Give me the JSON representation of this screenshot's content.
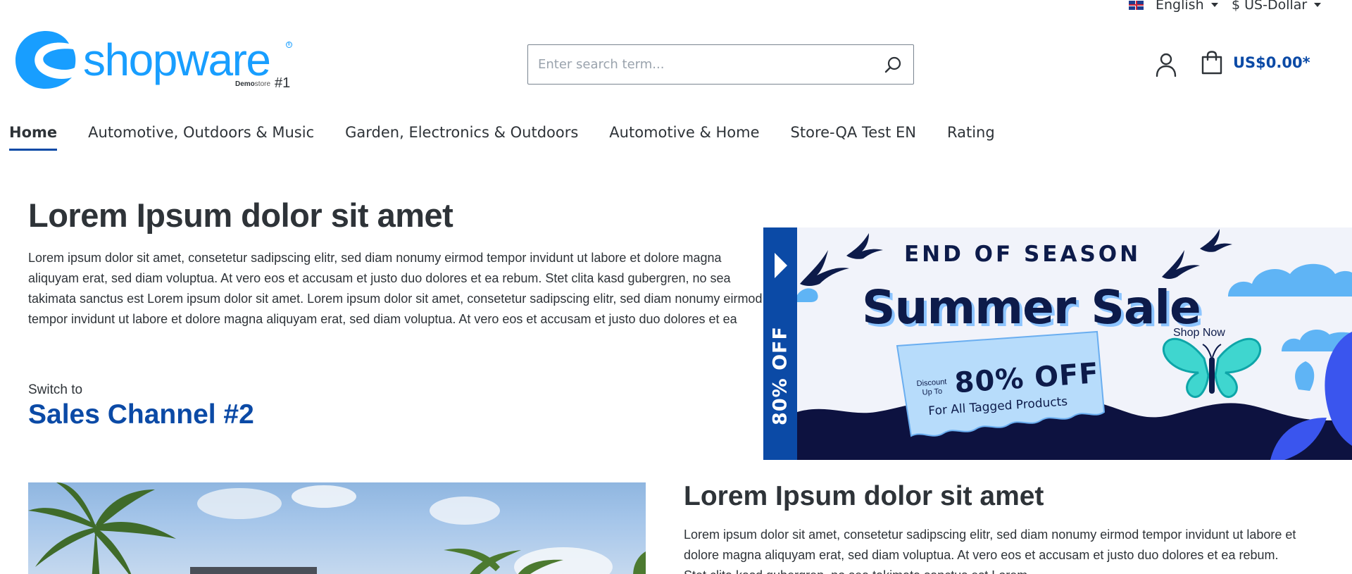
{
  "topbar": {
    "language": "English",
    "currency": "$ US-Dollar"
  },
  "header": {
    "logo_text": "shopware",
    "logo_sub_bold": "Demo",
    "logo_sub": "store",
    "logo_num": "#1",
    "search_placeholder": "Enter search term...",
    "cart_amount": "US$0.00*"
  },
  "nav": {
    "items": [
      {
        "label": "Home",
        "active": true
      },
      {
        "label": "Automotive, Outdoors & Music"
      },
      {
        "label": "Garden, Electronics & Outdoors"
      },
      {
        "label": "Automotive & Home"
      },
      {
        "label": "Store-QA Test EN"
      },
      {
        "label": "Rating"
      }
    ]
  },
  "content": {
    "heading": "Lorem Ipsum dolor sit amet",
    "paragraph": "Lorem ipsum dolor sit amet, consetetur sadipscing elitr, sed diam nonumy eirmod tempor invidunt ut labore et dolore magna aliquyam erat, sed diam voluptua. At vero eos et accusam et justo duo dolores et ea rebum. Stet clita kasd gubergren, no sea takimata sanctus est Lorem ipsum dolor sit amet. Lorem ipsum dolor sit amet, consetetur sadipscing elitr, sed diam nonumy eirmod tempor invidunt ut labore et dolore magna aliquyam erat, sed diam voluptua. At vero eos et accusam et justo duo dolores et ea rebum. Stet clita kasd gubergren, no sea takimata sanctus est Lorem ipsum dolor sit amet.",
    "switch_label": "Switch to",
    "switch_link": "Sales Channel #2"
  },
  "banner": {
    "strip_text": "80% OFF",
    "eyebrow": "END OF SEASON",
    "title": "Summer Sale",
    "shop_now": "Shop Now",
    "discount_small_1": "Discount",
    "discount_small_2": "Up To",
    "discount_big": "80% OFF",
    "discount_sub": "For All Tagged Products"
  },
  "section2": {
    "heading": "Lorem Ipsum dolor sit amet",
    "paragraph": "Lorem ipsum dolor sit amet, consetetur sadipscing elitr, sed diam nonumy eirmod tempor invidunt ut labore et dolore magna aliquyam erat, sed diam voluptua. At vero eos et accusam et justo duo dolores et ea rebum. Stet clita kasd gubergren, no sea takimata sanctus est Lorem"
  },
  "colors": {
    "brand_blue": "#189eff",
    "primary": "#0b4aa6",
    "text": "#2e3338",
    "banner_navy": "#0d1b4a"
  }
}
